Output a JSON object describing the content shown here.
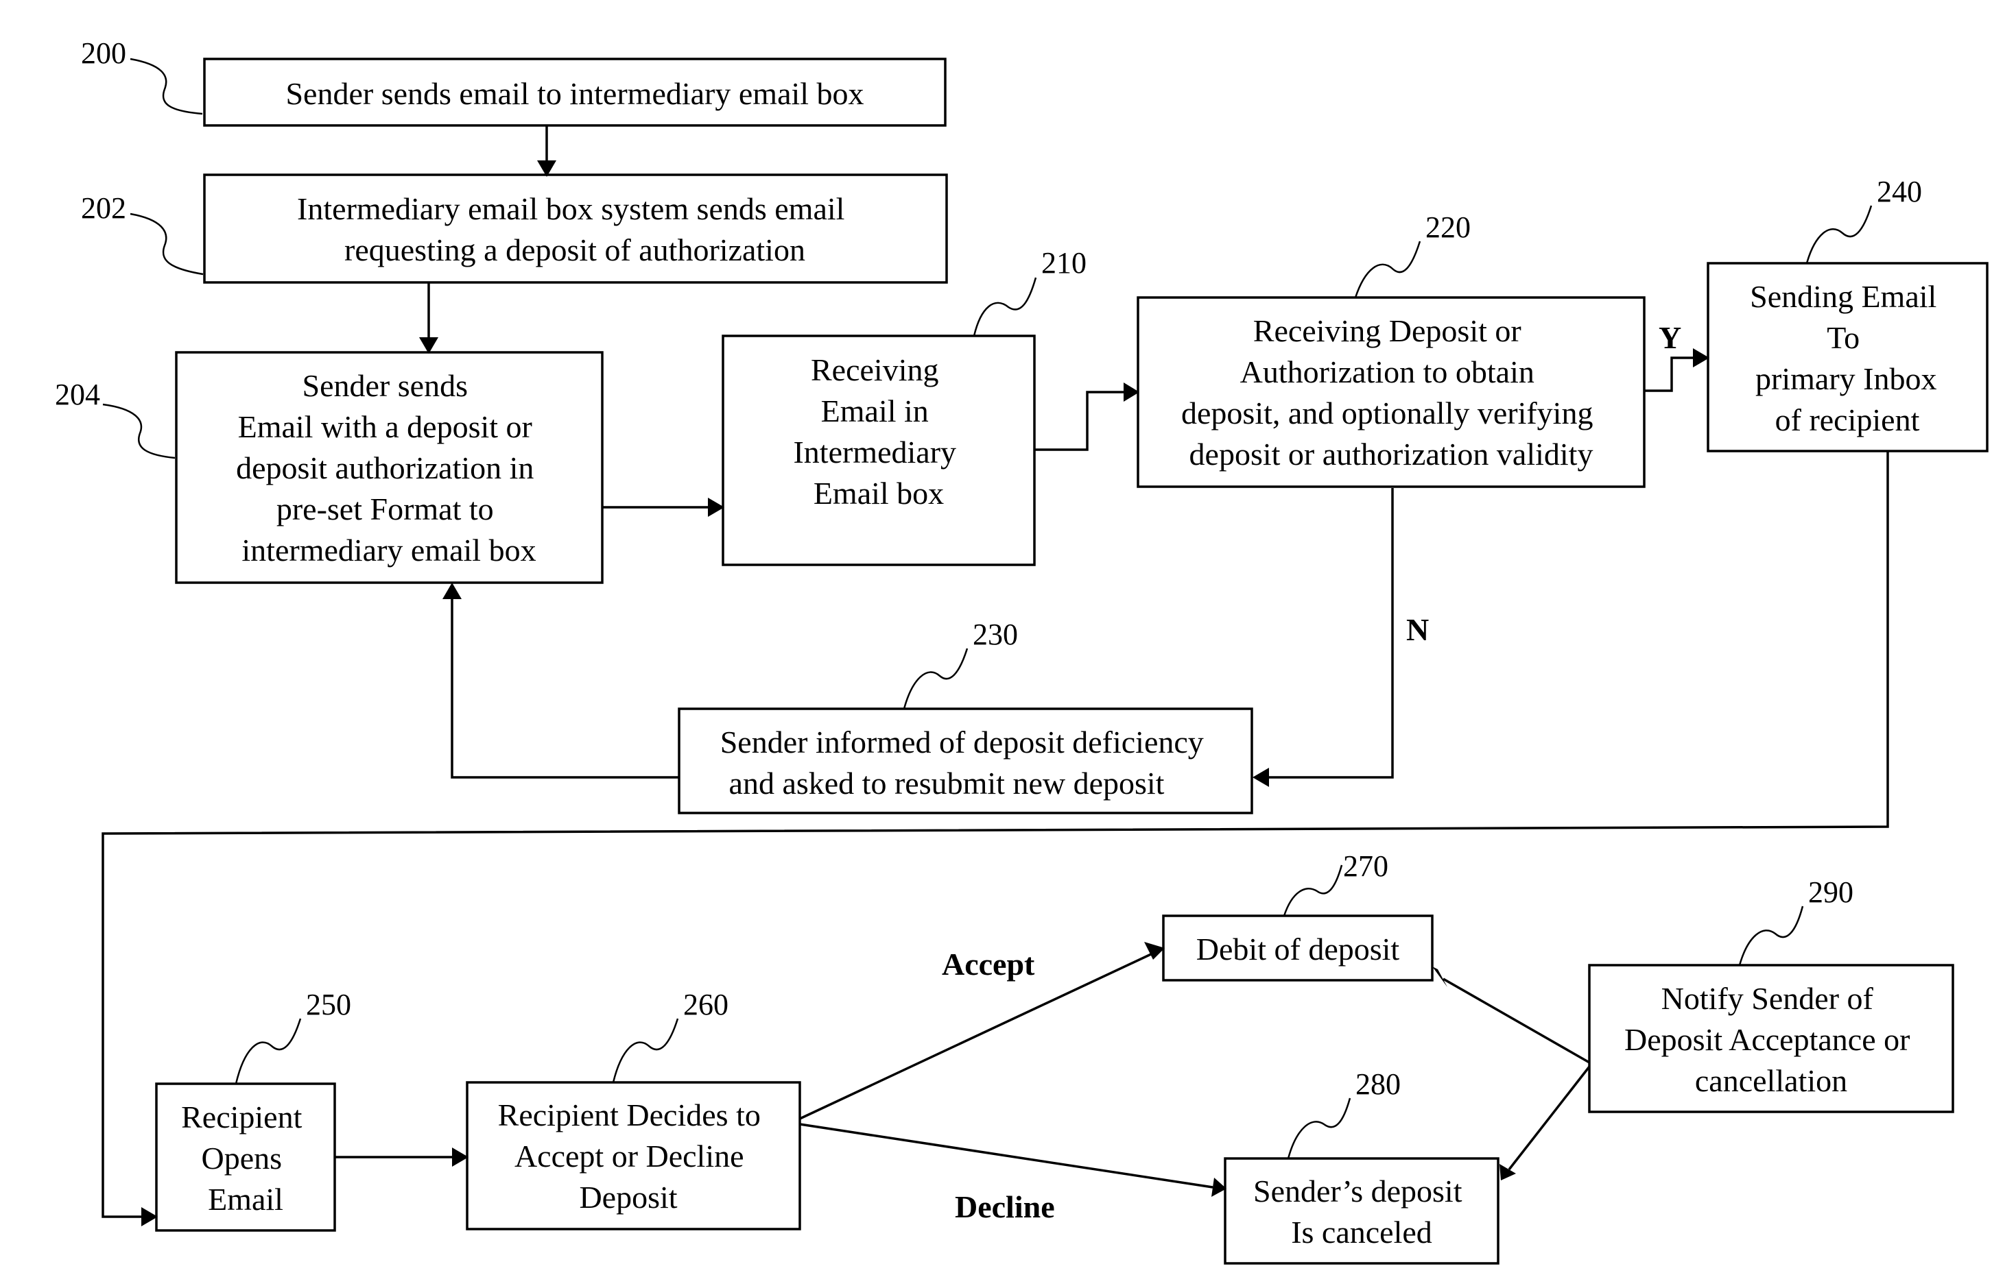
{
  "steps": {
    "s200": {
      "ref": "200",
      "lines": [
        "Sender sends email to intermediary email box"
      ]
    },
    "s202": {
      "ref": "202",
      "lines": [
        "Intermediary email box system sends email",
        "requesting a deposit of authorization"
      ]
    },
    "s204": {
      "ref": "204",
      "lines": [
        "Sender sends",
        "Email with a deposit or",
        "deposit authorization in",
        "pre-set Format to",
        "intermediary email box"
      ]
    },
    "s210": {
      "ref": "210",
      "lines": [
        "Receiving",
        "Email in",
        "Intermediary",
        "Email box"
      ]
    },
    "s220": {
      "ref": "220",
      "lines": [
        "Receiving Deposit or",
        "Authorization to obtain",
        "deposit, and optionally verifying",
        "deposit or authorization validity"
      ]
    },
    "s230": {
      "ref": "230",
      "lines": [
        "Sender informed of deposit deficiency",
        "and asked to resubmit new deposit"
      ]
    },
    "s240": {
      "ref": "240",
      "lines": [
        "Sending Email",
        "To",
        "primary Inbox",
        "of recipient"
      ]
    },
    "s250": {
      "ref": "250",
      "lines": [
        "Recipient",
        "Opens",
        "Email"
      ]
    },
    "s260": {
      "ref": "260",
      "lines": [
        "Recipient Decides to",
        "Accept or Decline",
        "Deposit"
      ]
    },
    "s270": {
      "ref": "270",
      "lines": [
        "Debit of deposit"
      ]
    },
    "s280": {
      "ref": "280",
      "lines": [
        "Sender’s deposit",
        "Is canceled"
      ]
    },
    "s290": {
      "ref": "290",
      "lines": [
        "Notify Sender of",
        "Deposit Acceptance or",
        "cancellation"
      ]
    }
  },
  "branch_labels": {
    "yes": "Y",
    "no": "N",
    "accept": "Accept",
    "decline": "Decline"
  }
}
